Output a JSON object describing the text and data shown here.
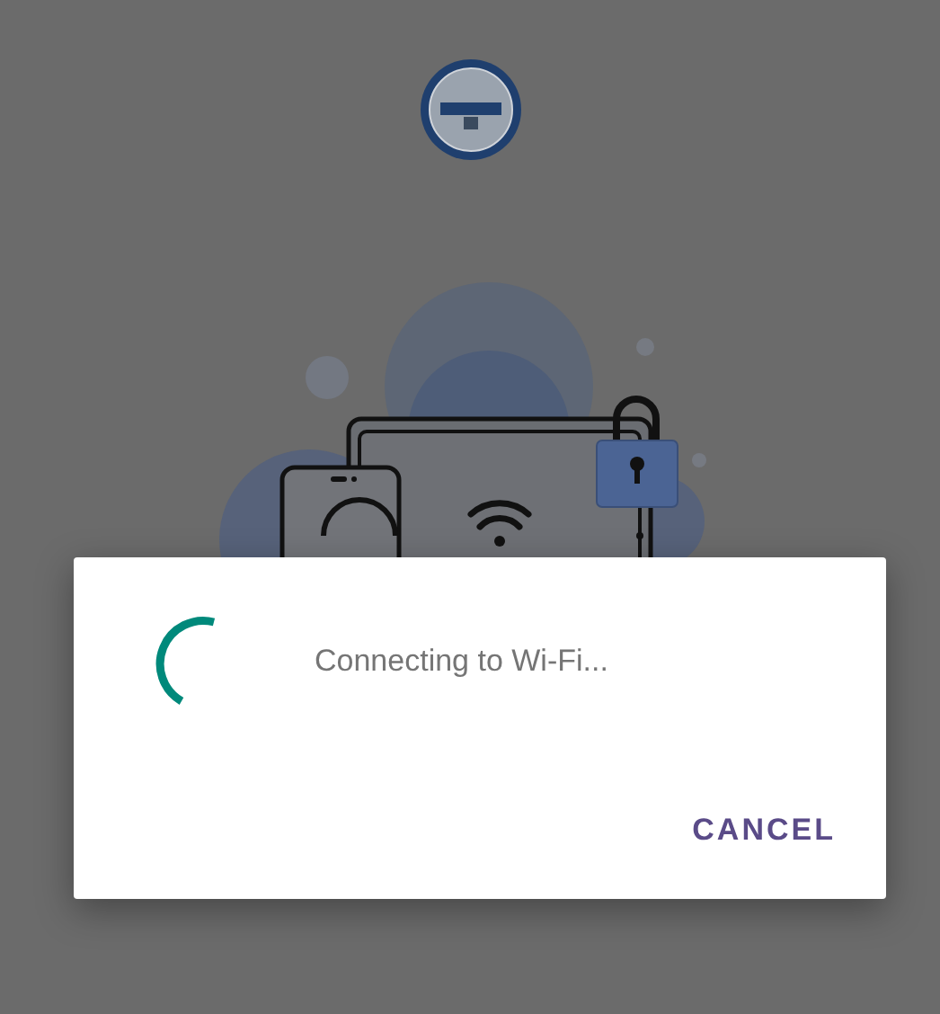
{
  "dialog": {
    "message": "Connecting to Wi-Fi...",
    "buttons": [
      "CANCEL"
    ]
  }
}
